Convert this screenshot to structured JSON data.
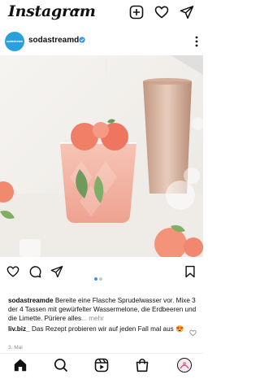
{
  "app": {
    "brand": "Instagram"
  },
  "post": {
    "username": "sodastreamde",
    "avatar_text": "sodastream",
    "caption_username": "sodastreamde",
    "caption_text": "Bereite eine Flasche Sprudelwasser vor. Mixe 3 der 4 Tassen mit gewürfelter Wassermelone, die Erdbeeren und die Limette. Püriere alles",
    "more_label": "... mehr",
    "comment_username": "liv.biz_",
    "comment_text": "Das Rezept probieren wir auf jeden Fall mal aus 😍",
    "date": "3. Mai",
    "carousel": {
      "count": 2,
      "active": 1
    }
  },
  "colors": {
    "accent": "#3897f0",
    "avatar_bg": "#2aa1dc",
    "muted": "#8e8e8e"
  },
  "icons": {
    "top": [
      "chevron-down-icon",
      "add-post-icon",
      "heart-icon",
      "direct-message-icon"
    ],
    "actions": [
      "like-icon",
      "comment-icon",
      "share-icon",
      "bookmark-icon"
    ],
    "nav": [
      "home-icon",
      "search-icon",
      "reels-icon",
      "shop-icon",
      "profile-avatar"
    ]
  }
}
